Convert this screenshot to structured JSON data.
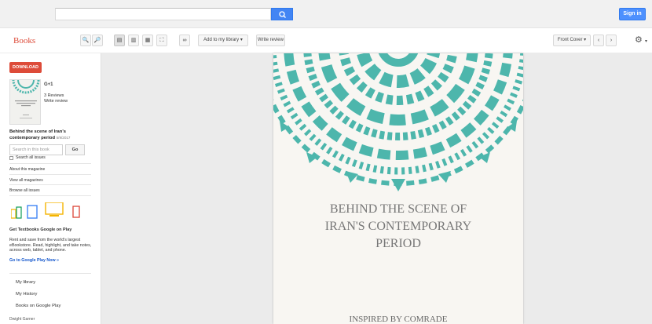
{
  "header": {
    "search_placeholder": "",
    "signin_label": "Sign in"
  },
  "toolbar": {
    "brand": "Books",
    "add_library_label": "Add to my library",
    "write_review_label": "Write review",
    "front_cover_label": "Front Cover"
  },
  "sidebar": {
    "download_label": "DOWNLOAD",
    "gplus_label": "G+1",
    "reviews_label": "3 Reviews",
    "write_review_label": "Write review",
    "book_title": "Behind the scene of Iran's contemporary period",
    "book_date": "5/9/2017",
    "search_book_placeholder": "Search in this book",
    "go_label": "Go",
    "search_all_issues": "Search all issues",
    "about_magazine": "About this magazine",
    "view_all_magazines": "View all magazines",
    "browse_all_issues": "Browse all issues",
    "promo_title": "Get Textbooks Google on Play",
    "promo_text": "Rent and save from the world's largest eBookstore. Read, highlight, and take notes, across web, tablet, and phone.",
    "promo_link": "Go to Google Play Now »",
    "nav_items": [
      "My library",
      "My History",
      "Books on Google Play"
    ],
    "author": "Dwight Garner"
  },
  "page": {
    "title_lines": [
      "BEHIND THE SCENE  OF",
      "IRAN'S CONTEMPORARY",
      "PERIOD"
    ],
    "subtitle": "INSPIRED BY COMRADE"
  },
  "colors": {
    "accent": "#dd4b39",
    "teal": "#4db6ac",
    "link": "#1155cc"
  }
}
